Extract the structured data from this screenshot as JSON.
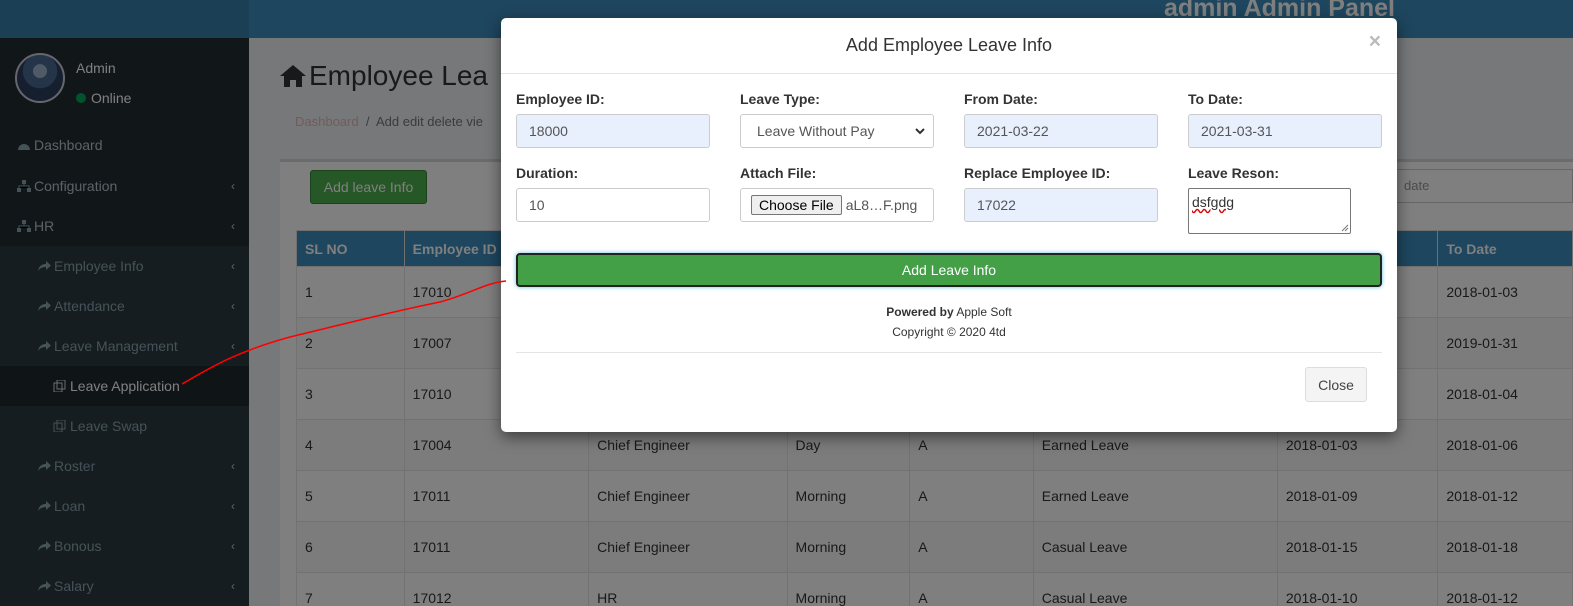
{
  "header": {
    "brand": "admin Admin Panel"
  },
  "sidebar": {
    "user": {
      "name": "Admin",
      "status": "Online"
    },
    "items": [
      {
        "label": "Dashboard",
        "icon": "dashboard-icon"
      },
      {
        "label": "Configuration",
        "icon": "sitemap-icon"
      },
      {
        "label": "HR",
        "icon": "sitemap-icon"
      },
      {
        "label": "Employee Info",
        "icon": "share-icon"
      },
      {
        "label": "Attendance",
        "icon": "share-icon"
      },
      {
        "label": "Leave Management",
        "icon": "share-icon"
      },
      {
        "label": "Leave Application",
        "icon": "copy-icon"
      },
      {
        "label": "Leave Swap",
        "icon": "copy-icon"
      },
      {
        "label": "Roster",
        "icon": "share-icon"
      },
      {
        "label": "Loan",
        "icon": "share-icon"
      },
      {
        "label": "Bonous",
        "icon": "share-icon"
      },
      {
        "label": "Salary",
        "icon": "share-icon"
      }
    ]
  },
  "page": {
    "title": "Employee Lea",
    "breadcrumb": {
      "home": "Dashboard",
      "separator": "/",
      "current": "Add edit delete vie"
    },
    "add_button": "Add leave Info",
    "search_placeholder": "date"
  },
  "table": {
    "columns": [
      "SL NO",
      "Employee ID",
      "",
      "",
      "",
      "",
      "",
      "To Date"
    ],
    "rows": [
      [
        "1",
        "17010",
        "",
        "",
        "",
        "",
        "",
        "2018-01-03"
      ],
      [
        "2",
        "17007",
        "",
        "",
        "",
        "",
        "",
        "2019-01-31"
      ],
      [
        "3",
        "17010",
        "",
        "",
        "",
        "",
        "",
        "2018-01-04"
      ],
      [
        "4",
        "17004",
        "Chief Engineer",
        "Day",
        "A",
        "Earned Leave",
        "2018-01-03",
        "2018-01-06"
      ],
      [
        "5",
        "17011",
        "Chief Engineer",
        "Morning",
        "A",
        "Earned Leave",
        "2018-01-09",
        "2018-01-12"
      ],
      [
        "6",
        "17011",
        "Chief Engineer",
        "Morning",
        "A",
        "Casual Leave",
        "2018-01-15",
        "2018-01-18"
      ],
      [
        "7",
        "17012",
        "HR",
        "Morning",
        "A",
        "Casual Leave",
        "2018-01-10",
        "2018-01-12"
      ]
    ]
  },
  "modal": {
    "title": "Add Employee Leave Info",
    "close_x": "×",
    "fields": {
      "employee_id": {
        "label": "Employee ID:",
        "value": "18000"
      },
      "leave_type": {
        "label": "Leave Type:",
        "value": "Leave Without Pay"
      },
      "from_date": {
        "label": "From Date:",
        "value": "2021-03-22"
      },
      "to_date": {
        "label": "To Date:",
        "value": "2021-03-31"
      },
      "duration": {
        "label": "Duration:",
        "value": "10"
      },
      "attach_file": {
        "label": "Attach File:",
        "button": "Choose File",
        "filename": "aL8…F.png"
      },
      "replace_employee_id": {
        "label": "Replace Employee ID:",
        "value": "17022"
      },
      "leave_reason": {
        "label": "Leave Reson:",
        "value": "dsfgdg"
      }
    },
    "submit": "Add Leave Info",
    "powered_prefix": "Powered by",
    "powered_name": "Apple Soft",
    "copyright": "Copyright © 2020 4td",
    "close_button": "Close"
  },
  "colors": {
    "header": "#3c8dbc",
    "sidebar": "#222d32",
    "success": "#43a047",
    "annotation": "#ff0000"
  }
}
